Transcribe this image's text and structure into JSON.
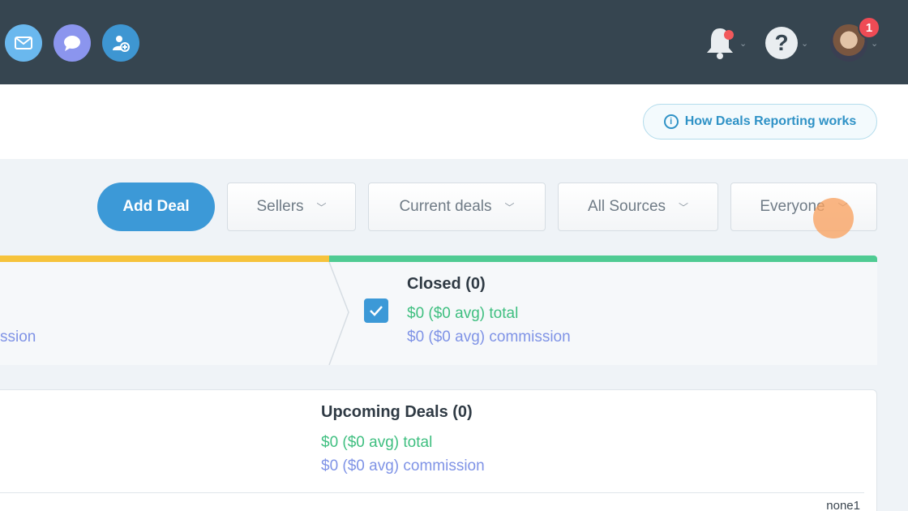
{
  "nav": {
    "icons": [
      "mail-icon",
      "chat-icon",
      "add-contact-icon"
    ],
    "notifications_icon": "bell-icon",
    "help_label": "?",
    "profile_badge": "1",
    "colors": {
      "bar": "#364550",
      "mail": "#6ab8ee",
      "chat": "#8b95ee",
      "contact": "#3e96d2",
      "badge": "#ef4b55"
    }
  },
  "header": {
    "help_link": "How Deals Reporting works",
    "help_link_icon": "info-icon"
  },
  "toolbar": {
    "add_deal": "Add Deal",
    "filters": [
      {
        "label": "Sellers"
      },
      {
        "label": "Current deals"
      },
      {
        "label": "All Sources"
      },
      {
        "label": "Everyone"
      }
    ]
  },
  "pipeline": {
    "left_stage_commission_fragment": "ssion",
    "closed": {
      "title": "Closed (0)",
      "total": "$0 ($0 avg) total",
      "commission": "$0 ($0 avg) commission",
      "checked": true
    },
    "colors": {
      "left_bar": "#f6c33c",
      "closed_bar": "#4fcb93"
    }
  },
  "upcoming": {
    "title": "Upcoming Deals (0)",
    "total": "$0 ($0 avg) total",
    "commission": "$0 ($0 avg) commission",
    "footer_value": "none1"
  }
}
